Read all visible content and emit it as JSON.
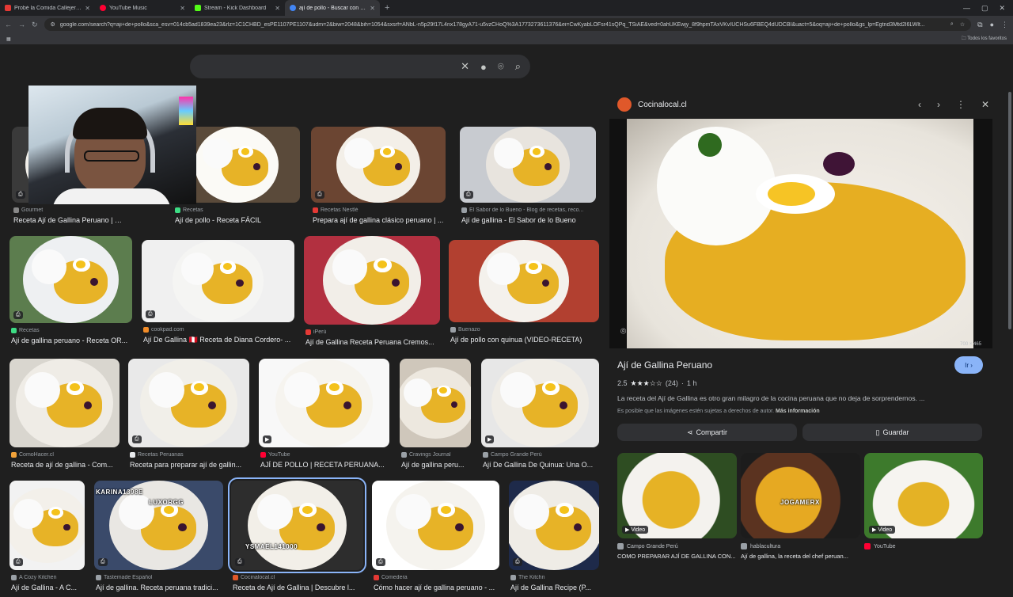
{
  "browser": {
    "tabs": [
      {
        "label": "Probé la Comida Callejera de Tu",
        "color": "#e53935"
      },
      {
        "label": "YouTube Music",
        "color": "#ff0033"
      },
      {
        "label": "Stream - Kick Dashboard",
        "color": "#53fc18"
      },
      {
        "label": "ají de pollo - Buscar con Googl",
        "color": "#4285f4"
      }
    ],
    "url": "google.com/search?q=aji+de+pollo&sca_esv=014cb5ad1839ea23&rlz=1C1CHBD_esPE1107PE1107&udm=2&biw=2048&bih=1054&sxsrf=ANbL-n5p29f17L4nx178gyA71-u5vzCHoQ%3A1773273611376&ei=CwKyabLOFsr41sQPq_TSiAE&ved=0ahUKEwjy_8f9hpmTAxVKvIUCHSu6FBEQ4dUDCBI&uact=5&oq=aji+de+pollo&gs_lp=Egtnd3Mtd2l6LWlt...",
    "bookmarks_label": "Todos los favoritos"
  },
  "search": {
    "clear_icon": "✕",
    "mic_icon": "🎤"
  },
  "results": [
    {
      "source": "Gourmet",
      "title": "Receta Ají de Gallina Peruano | Gourmet",
      "color": "#888"
    },
    {
      "source": "Recetas",
      "title": "Ají de pollo - Receta FÁCIL",
      "color": "#3ddc84"
    },
    {
      "source": "Recetas Nestlé",
      "title": "Prepara ají de gallina clásico peruano | ...",
      "color": "#e53935"
    },
    {
      "source": "El Sabor de lo Bueno - Blog de recetas, reco...",
      "title": "Ají de gallina - El Sabor de lo Bueno",
      "color": "#9aa0a6"
    },
    {
      "source": "Recetas",
      "title": "Ají de gallina peruano - Receta OR...",
      "color": "#3ddc84"
    },
    {
      "source": "cookpad.com",
      "title": "Ají De Gallina 🇵🇪 Receta de Diana Cordero- ...",
      "color": "#f28c28"
    },
    {
      "source": "iPerú",
      "title": "Ají de Gallina Receta Peruana Cremos...",
      "color": "#e53935"
    },
    {
      "source": "Buenazo",
      "title": "Ají de pollo con quinua (VIDEO-RECETA)",
      "color": "#9aa0a6"
    },
    {
      "source": "ComoHacer.cl",
      "title": "Receta de ají de gallina - Com...",
      "color": "#f2a33a"
    },
    {
      "source": "Recetas Peruanas",
      "title": "Receta para preparar ají de gallin...",
      "color": "#e8eaed"
    },
    {
      "source": "YouTube",
      "title": "AJÍ DE POLLO | RECETA PERUANA...",
      "color": "#ff0033"
    },
    {
      "source": "Cravings Journal",
      "title": "Ají de gallina peru...",
      "color": "#9aa0a6"
    },
    {
      "source": "Campo Grande Perú",
      "title": "Ají De Gallina De Quinua: Una O...",
      "color": "#9aa0a6"
    },
    {
      "source": "A Cozy Kitchen",
      "title": "Ají de Gallina - A C...",
      "color": "#9aa0a6"
    },
    {
      "source": "Tastemade Español",
      "title": "Ají de gallina. Receta peruana tradici...",
      "color": "#9aa0a6"
    },
    {
      "source": "Cocinalocal.cl",
      "title": "Receta de Ají de Gallina | Descubre l...",
      "color": "#e0582a"
    },
    {
      "source": "Comedera",
      "title": "Cómo hacer ají de gallina peruano - ...",
      "color": "#e53935"
    },
    {
      "source": "The Kitchn",
      "title": "Ají de Gallina Recipe (P...",
      "color": "#9aa0a6"
    }
  ],
  "overlays": {
    "donor1": "KARINA1398E",
    "donor2": "LUXORGG",
    "donor3": "YSMAEL141000",
    "donor4": "JOGAMERX"
  },
  "panel": {
    "site": "Cocinalocal.cl",
    "dimensions": "700 × 465",
    "title": "Ají de Gallina Peruano",
    "go_label": "Ir",
    "rating_value": "2.5",
    "rating_stars": "★★★☆☆",
    "rating_count": "(24)",
    "time": "1 h",
    "description": "La receta del Ají de Gallina es otro gran milagro de la cocina peruana que no deja de sorprendernos. ...",
    "rights_note": "Es posible que las imágenes estén sujetas a derechos de autor.",
    "more_info": "Más información",
    "share_label": "Compartir",
    "save_label": "Guardar",
    "related": [
      {
        "tag": "Video",
        "source": "Campo Grande Perú",
        "title": "COMO PREPARAR AJÍ DE GALLINA CON..."
      },
      {
        "tag": "",
        "source": "hablacultura",
        "title": "Ají de gallina, la receta del chef peruan..."
      },
      {
        "tag": "Video",
        "source": "YouTube",
        "title": ""
      }
    ]
  }
}
